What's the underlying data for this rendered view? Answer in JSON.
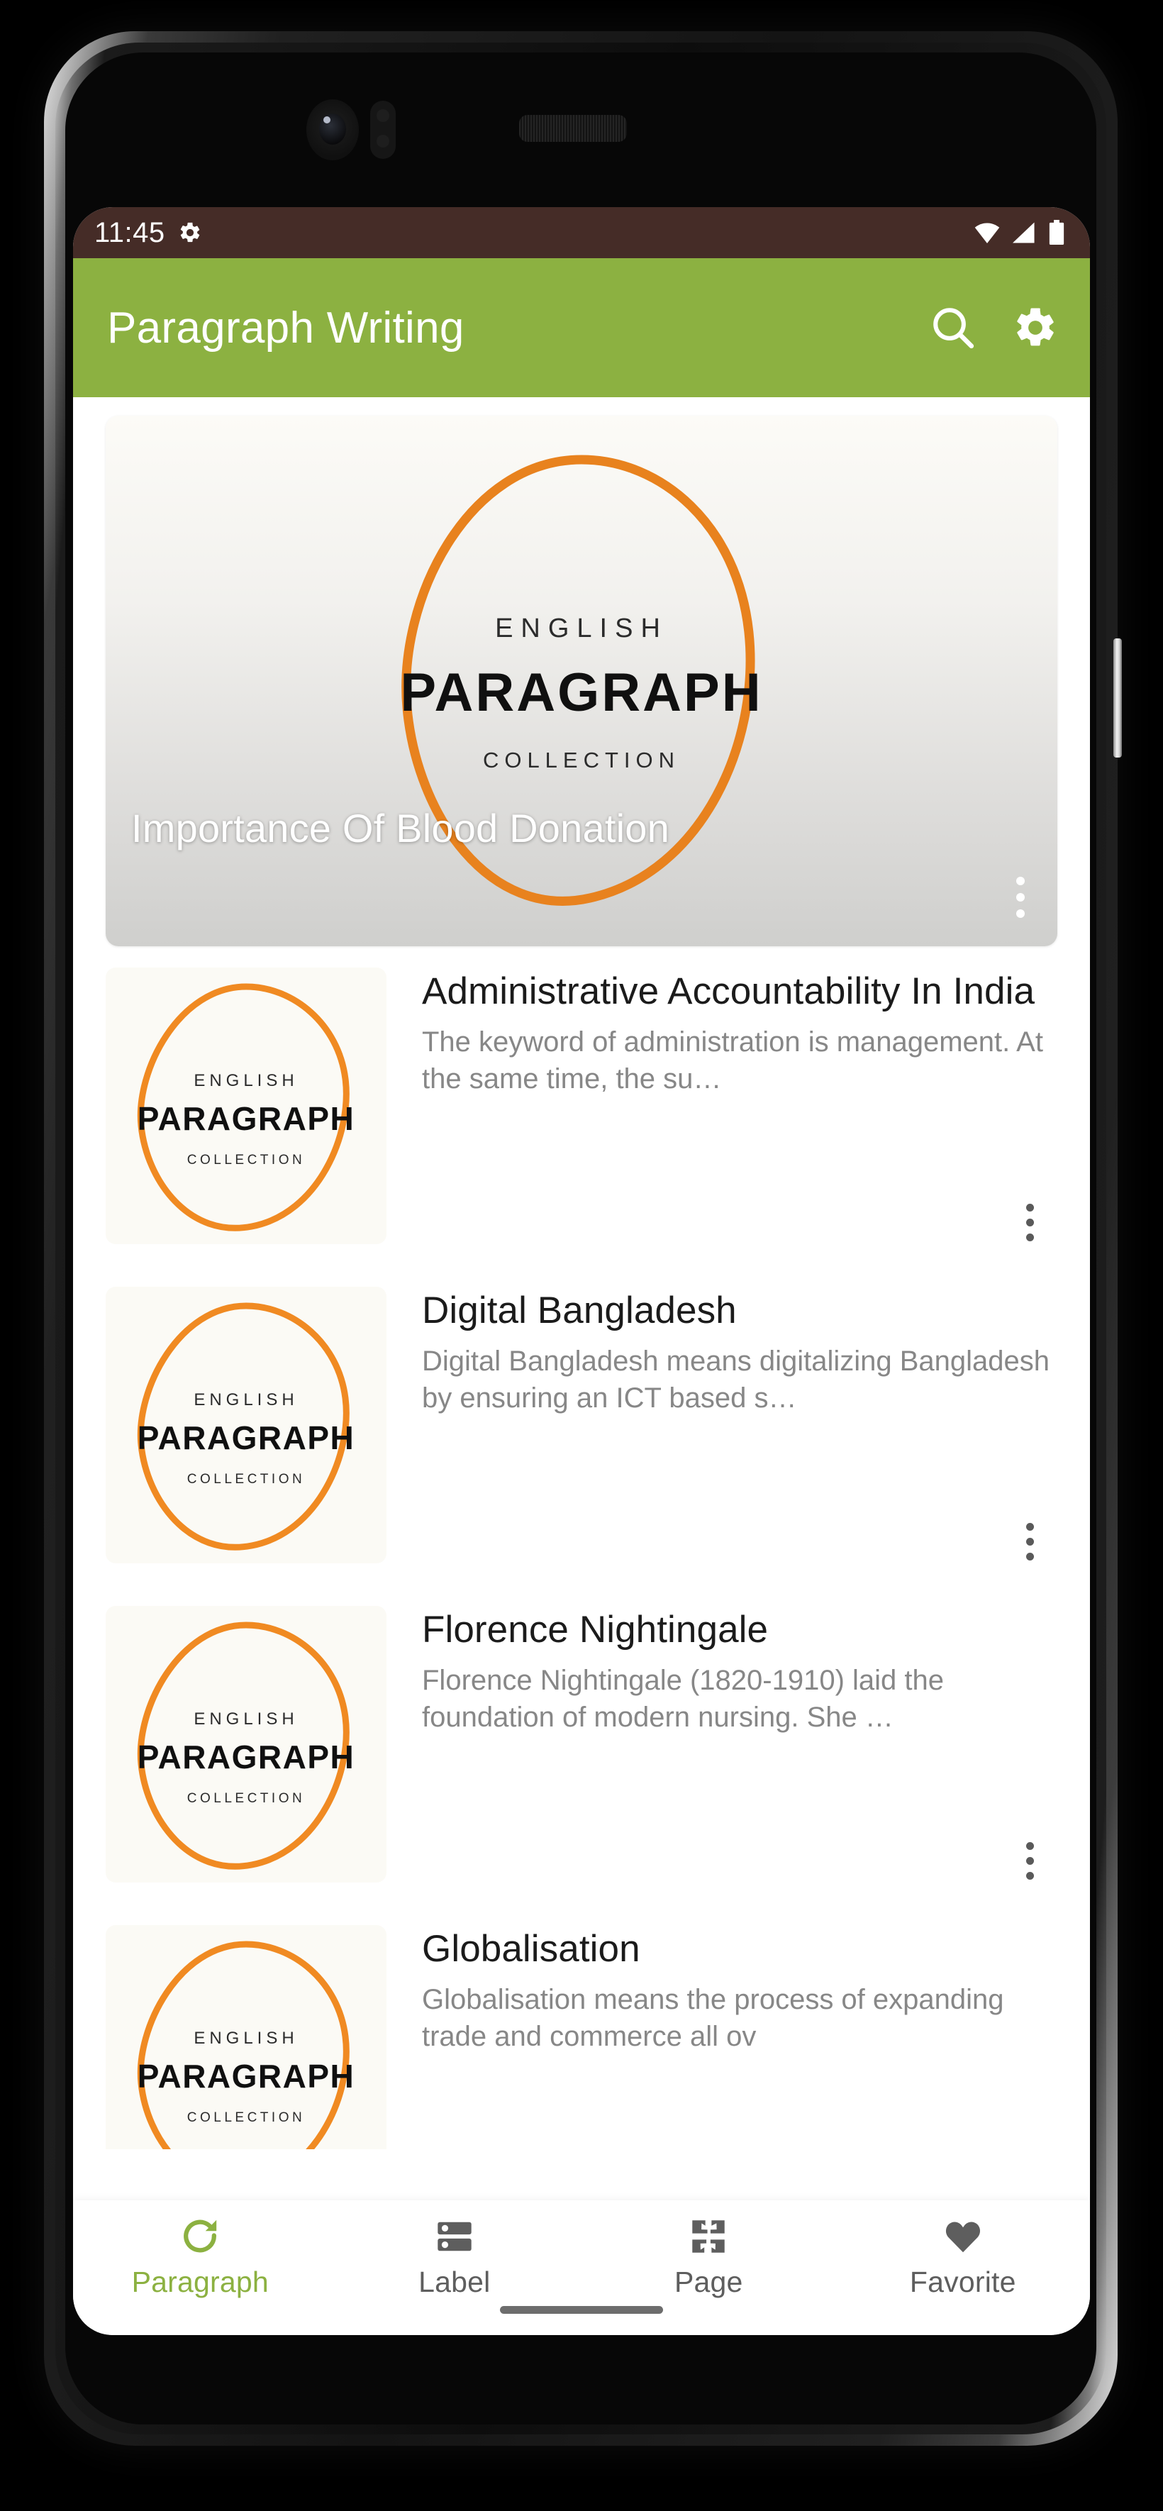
{
  "status_bar": {
    "time": "11:45",
    "icons": [
      "gear-icon",
      "wifi-icon",
      "signal-icon",
      "battery-icon"
    ],
    "background_color": "#452c27"
  },
  "app_bar": {
    "title": "Paragraph Writing",
    "background_color": "#8cb141",
    "actions": [
      {
        "name": "search-icon",
        "label": "Search"
      },
      {
        "name": "gear-icon",
        "label": "Settings"
      }
    ]
  },
  "logo": {
    "line1": "ENGLISH",
    "line2": "PARAGRAPH",
    "line3": "COLLECTION",
    "outline_color": "#e8821e"
  },
  "featured": {
    "title": "Importance Of Blood Donation",
    "overflow_menu": "more-options"
  },
  "list": [
    {
      "title": "Administrative Accountability In India",
      "description": "The keyword of administration is management. At the same time, the su…"
    },
    {
      "title": "Digital Bangladesh",
      "description": "Digital Bangladesh means digitalizing Bangladesh by ensuring an ICT based s…"
    },
    {
      "title": "Florence Nightingale",
      "description": "Florence Nightingale (1820-1910) laid the foundation of modern nursing. She …"
    },
    {
      "title": "Globalisation",
      "description": "Globalisation means the process of expanding trade and commerce all ov"
    }
  ],
  "bottom_nav": {
    "active_color": "#8cb141",
    "inactive_color": "#5e5e5e",
    "items": [
      {
        "label": "Paragraph",
        "icon": "refresh-icon",
        "active": true
      },
      {
        "label": "Label",
        "icon": "storage-icon",
        "active": false
      },
      {
        "label": "Page",
        "icon": "fullscreen-exit-icon",
        "active": false
      },
      {
        "label": "Favorite",
        "icon": "heart-icon",
        "active": false
      }
    ]
  }
}
